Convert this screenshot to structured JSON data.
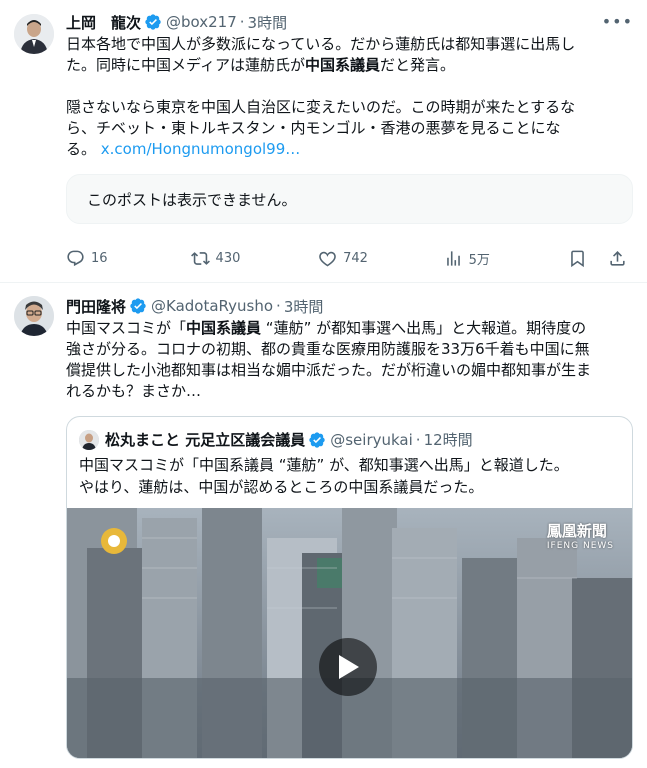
{
  "posts": [
    {
      "name": "上岡　龍次",
      "handle": "@box217",
      "time": "3時間",
      "text_l1": "日本各地で中国人が多数派になっている。だから蓮舫氏は都知事選に出馬し",
      "text_l2_a": "た。同時に中国メディアは蓮舫氏が",
      "text_l2_b": "中国系議員",
      "text_l2_c": "だと発言。",
      "text_l4": "隠さないなら東京を中国人自治区に変えたいのだ。この時期が来たとするな",
      "text_l5": "ら、チベット・東トルキスタン・内モンゴル・香港の悪夢を見ることにな",
      "text_l6": "る。 ",
      "link": "x.com/Hongnumongol99…",
      "unavailable": "このポストは表示できません。",
      "replies": "16",
      "reposts": "430",
      "likes": "742",
      "views": "5万"
    },
    {
      "name": "門田隆将",
      "handle": "@KadotaRyusho",
      "time": "3時間",
      "text_l1_a": "中国マスコミが「",
      "text_l1_b": "中国系議員",
      "text_l1_c": " “蓮舫” が都知事選へ出馬」と大報道。期待度の",
      "text_l2": "強さが分る。コロナの初期、都の貴重な医療用防護服を33万6千着も中国に無",
      "text_l3": "償提供した小池都知事は相当な媚中派だった。だが桁違いの媚中都知事が生ま",
      "text_l4": "れるかも？まさか…",
      "quote": {
        "name": "松丸まこと 元足立区議会議員",
        "handle": "@seiryukai",
        "time": "12時間",
        "text_l1": "中国マスコミが「中国系議員 “蓮舫” が、都知事選へ出馬」と報道した。",
        "text_l2": "やはり、蓮舫は、中国が認めるところの中国系議員だった。",
        "media_logo": "鳳凰新聞",
        "media_logo_sub": "IFENG NEWS"
      }
    }
  ],
  "colors": {
    "accent": "#1d9bf0",
    "muted": "#536471",
    "text": "#0f1419"
  },
  "icons": [
    "verified-badge-icon",
    "more-icon",
    "reply-icon",
    "repost-icon",
    "like-icon",
    "views-icon",
    "bookmark-icon",
    "share-icon",
    "play-icon"
  ]
}
